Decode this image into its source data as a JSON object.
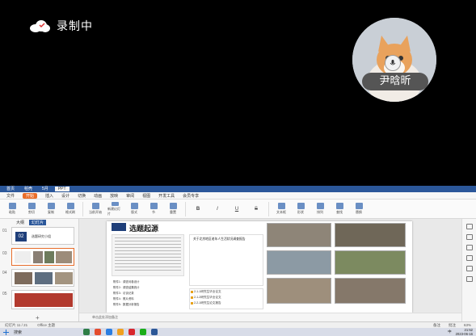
{
  "overlay": {
    "recording_label": "录制中",
    "user_name": "尹晗昕"
  },
  "app": {
    "title_tabs": [
      "首页",
      "稻壳",
      "5月",
      "PPT"
    ],
    "menu": [
      "文件",
      "开始",
      "插入",
      "设计",
      "切换",
      "动画",
      "放映",
      "审阅",
      "视图",
      "开发工具",
      "会员专享"
    ],
    "active_menu": "开始",
    "ribbon_buttons": [
      "粘贴",
      "剪切",
      "复制",
      "格式刷",
      "当前开始",
      "新建幻灯片",
      "版式",
      "节",
      "重置",
      "B",
      "I",
      "U",
      "S",
      "文本框",
      "形状",
      "排列",
      "查找",
      "替换"
    ],
    "thumb_tabs": [
      "大纲",
      "幻灯片"
    ],
    "thumb_numbers": [
      "01",
      "02",
      "03",
      "04",
      "05"
    ],
    "thumb_heading": "选题研究小组",
    "slide": {
      "title": "选题起源",
      "doc_heading": "关于北京地区老年人生活状况调查报告",
      "list": [
        "附件1：调查问卷设计",
        "附件2：调查结果统计",
        "附件3：访谈记录",
        "附件4：照片资料",
        "附件5：数据分析报告"
      ],
      "files": [
        "2-1-1研究生毕业论文",
        "2-1-2研究生毕业论文",
        "2-2-1研究生论文报告"
      ]
    },
    "notes_placeholder": "单击此处添加备注",
    "status": {
      "slide_pos": "幻灯片 11 / 21",
      "theme": "Office 主题",
      "zoom": "63%",
      "notes": "备注",
      "comments": "批注"
    }
  },
  "taskbar": {
    "search_label": "搜索",
    "lang": "中",
    "time": "21:52",
    "date": "2023-06-16"
  }
}
